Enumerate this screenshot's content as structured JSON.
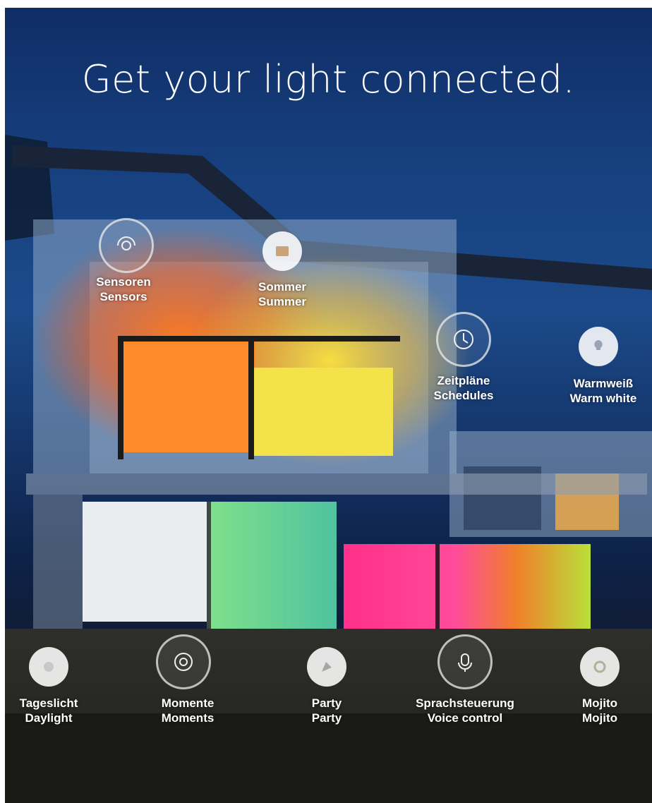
{
  "title": "Get your light connected.",
  "features": [
    {
      "id": "sensors",
      "de": "Sensoren",
      "en": "Sensors",
      "icon": "sensor-icon"
    },
    {
      "id": "summer",
      "de": "Sommer",
      "en": "Summer",
      "icon": "summer-scene-icon"
    },
    {
      "id": "schedules",
      "de": "Zeitpläne",
      "en": "Schedules",
      "icon": "clock-icon"
    },
    {
      "id": "warm-white",
      "de": "Warmweiß",
      "en": "Warm white",
      "icon": "bulb-icon"
    },
    {
      "id": "daylight",
      "de": "Tageslicht",
      "en": "Daylight",
      "icon": "daylight-icon"
    },
    {
      "id": "moments",
      "de": "Momente",
      "en": "Moments",
      "icon": "moments-icon"
    },
    {
      "id": "party",
      "de": "Party",
      "en": "Party",
      "icon": "party-icon"
    },
    {
      "id": "voice-control",
      "de": "Sprachsteuerung",
      "en": "Voice control",
      "icon": "microphone-icon"
    },
    {
      "id": "mojito",
      "de": "Mojito",
      "en": "Mojito",
      "icon": "mojito-icon"
    }
  ],
  "colors": {
    "sky": "#17407f",
    "accent_orange": "#ff6a1a",
    "accent_yellow": "#ffd92e",
    "accent_pink": "#ff2fa0",
    "accent_green": "#7cf07a",
    "text": "#ffffff"
  }
}
